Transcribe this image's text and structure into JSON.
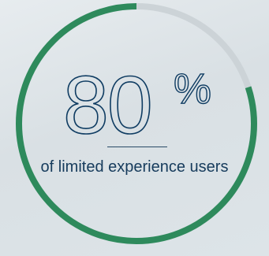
{
  "chart_data": {
    "type": "pie",
    "value": 80,
    "max": 100,
    "value_text": "80",
    "unit": "%",
    "caption": "of limited experience users"
  },
  "colors": {
    "filled": "#2e8a5c",
    "track": "#ccd3d7",
    "text": "#0f3c62",
    "background": "#e2e8eb"
  }
}
